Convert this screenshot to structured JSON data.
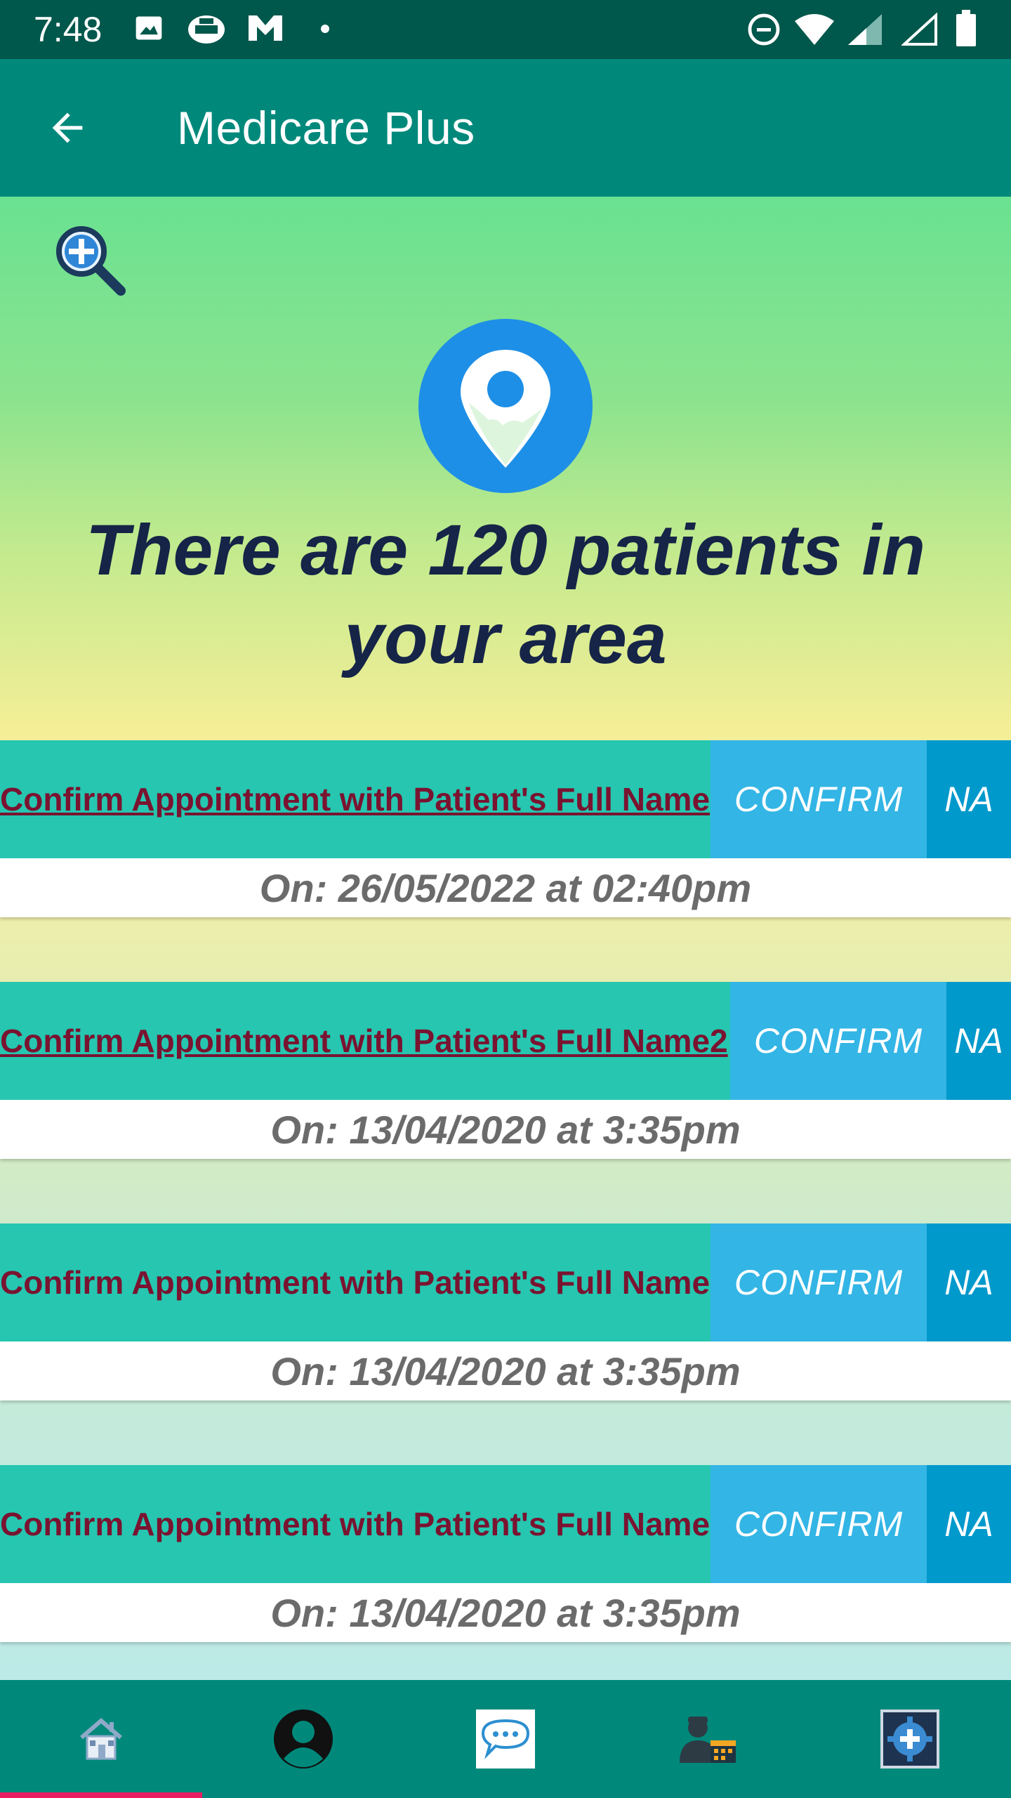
{
  "status_bar": {
    "time": "7:48",
    "left_icons": [
      "image-icon",
      "printer-icon",
      "gmail-icon",
      "dot-icon"
    ],
    "right_icons": [
      "do-not-disturb-icon",
      "wifi-icon",
      "signal-icon",
      "signal-empty-icon",
      "battery-icon"
    ]
  },
  "app_bar": {
    "title": "Medicare Plus",
    "back_icon": "arrow-back-icon"
  },
  "main": {
    "zoom_icon": "zoom-in-icon",
    "location_icon": "location-pin-icon",
    "headline": "There are 120 patients in your area"
  },
  "appointments": [
    {
      "name": "Confirm Appointment with Patient's Full Name",
      "confirm_label": "CONFIRM",
      "na_label": "NA",
      "date": "On: 26/05/2022 at 02:40pm",
      "linked": true
    },
    {
      "name": "Confirm Appointment with Patient's Full Name2",
      "confirm_label": "CONFIRM",
      "na_label": "NA",
      "date": "On: 13/04/2020 at 3:35pm",
      "linked": true
    },
    {
      "name": "Confirm Appointment with Patient's Full Name",
      "confirm_label": "CONFIRM",
      "na_label": "NA",
      "date": "On: 13/04/2020 at 3:35pm",
      "linked": false
    },
    {
      "name": "Confirm Appointment with Patient's Full Name",
      "confirm_label": "CONFIRM",
      "na_label": "NA",
      "date": "On: 13/04/2020 at 3:35pm",
      "linked": false
    }
  ],
  "bottom_nav": {
    "items": [
      {
        "icon": "home-icon",
        "active": true
      },
      {
        "icon": "profile-icon",
        "active": false
      },
      {
        "icon": "chat-icon",
        "active": false
      },
      {
        "icon": "doctor-schedule-icon",
        "active": false
      },
      {
        "icon": "settings-icon",
        "active": false
      }
    ]
  },
  "colors": {
    "status_bar": "#00574B",
    "app_bar": "#00897B",
    "appt_name_bg": "#26C6B0",
    "appt_name_text": "#7A1330",
    "confirm_bg": "#33B5E5",
    "na_bg": "#0099CC",
    "headline": "#152447",
    "nav_indicator": "#E91E63"
  }
}
